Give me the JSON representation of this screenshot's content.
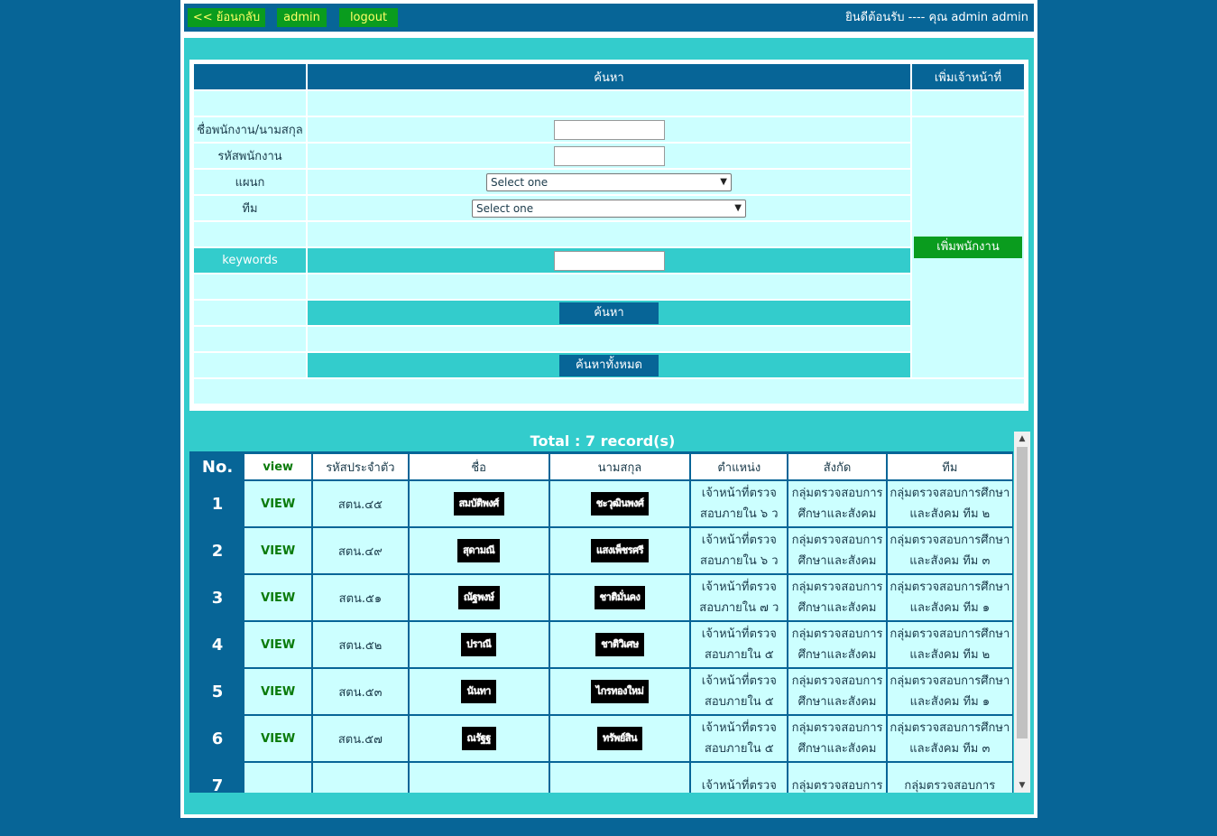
{
  "topbar": {
    "back_label": "<< ย้อนกลับ",
    "admin_label": "admin",
    "logout_label": "logout",
    "welcome_text": "ยินดีต้อนรับ ---- คุณ admin admin"
  },
  "search": {
    "header": "ค้นหา",
    "add_staff_header": "เพิ่มเจ้าหน้าที่",
    "name_label": "ชื่อพนักงาน/นามสกุล",
    "id_label": "รหัสพนักงาน",
    "department_label": "แผนก",
    "department_value": "Select one",
    "team_label": "ทีม",
    "team_value": "Select one",
    "keywords_label": "keywords",
    "search_button": "ค้นหา",
    "search_all_button": "ค้นหาทั้งหมด",
    "add_employee_button": "เพิ่มพนักงาน"
  },
  "results": {
    "total_text": "Total : 7 record(s)",
    "columns": {
      "no": "No.",
      "view": "view",
      "code": "รหัสประจำตัว",
      "first_name": "ชื่อ",
      "last_name": "นามสกุล",
      "position": "ตำแหน่ง",
      "affiliation": "สังกัด",
      "team": "ทีม"
    },
    "rows": [
      {
        "no": "1",
        "view": "VIEW",
        "code": "สตน.๔๕",
        "first_name": "สมบัติพงศ์",
        "last_name": "ชะวุฒินพงศ์",
        "position_1": "เจ้าหน้าที่ตรวจ",
        "position_2": "สอบภายใน ๖ ว",
        "aff_1": "กลุ่มตรวจสอบการ",
        "aff_2": "ศึกษาและสังคม",
        "team_1": "กลุ่มตรวจสอบการศึกษา",
        "team_2": "และสังคม ทีม ๒"
      },
      {
        "no": "2",
        "view": "VIEW",
        "code": "สตน.๔๙",
        "first_name": "สุดามณี",
        "last_name": "แสงเพ็ชรศรี",
        "position_1": "เจ้าหน้าที่ตรวจ",
        "position_2": "สอบภายใน ๖ ว",
        "aff_1": "กลุ่มตรวจสอบการ",
        "aff_2": "ศึกษาและสังคม",
        "team_1": "กลุ่มตรวจสอบการศึกษา",
        "team_2": "และสังคม ทีม ๓"
      },
      {
        "no": "3",
        "view": "VIEW",
        "code": "สตน.๕๑",
        "first_name": "ณัฐพงษ์",
        "last_name": "ชาติมั่นคง",
        "position_1": "เจ้าหน้าที่ตรวจ",
        "position_2": "สอบภายใน ๗ ว",
        "aff_1": "กลุ่มตรวจสอบการ",
        "aff_2": "ศึกษาและสังคม",
        "team_1": "กลุ่มตรวจสอบการศึกษา",
        "team_2": "และสังคม ทีม ๑"
      },
      {
        "no": "4",
        "view": "VIEW",
        "code": "สตน.๕๒",
        "first_name": "ปราณี",
        "last_name": "ชาติวิเศษ",
        "position_1": "เจ้าหน้าที่ตรวจ",
        "position_2": "สอบภายใน ๕",
        "aff_1": "กลุ่มตรวจสอบการ",
        "aff_2": "ศึกษาและสังคม",
        "team_1": "กลุ่มตรวจสอบการศึกษา",
        "team_2": "และสังคม ทีม ๒"
      },
      {
        "no": "5",
        "view": "VIEW",
        "code": "สตน.๕๓",
        "first_name": "นันทา",
        "last_name": "ไกรทองใหม่",
        "position_1": "เจ้าหน้าที่ตรวจ",
        "position_2": "สอบภายใน ๕",
        "aff_1": "กลุ่มตรวจสอบการ",
        "aff_2": "ศึกษาและสังคม",
        "team_1": "กลุ่มตรวจสอบการศึกษา",
        "team_2": "และสังคม ทีม ๑"
      },
      {
        "no": "6",
        "view": "VIEW",
        "code": "สตน.๕๗",
        "first_name": "ณรัฐฐ",
        "last_name": "ทรัพย์สิน",
        "position_1": "เจ้าหน้าที่ตรวจ",
        "position_2": "สอบภายใน ๕",
        "aff_1": "กลุ่มตรวจสอบการ",
        "aff_2": "ศึกษาและสังคม",
        "team_1": "กลุ่มตรวจสอบการศึกษา",
        "team_2": "และสังคม ทีม ๓"
      },
      {
        "no": "7",
        "view": "",
        "code": "",
        "first_name": "",
        "last_name": "",
        "position_1": "เจ้าหน้าที่ตรวจ",
        "position_2": "",
        "aff_1": "กลุ่มตรวจสอบการ",
        "aff_2": "",
        "team_1": "กลุ่มตรวจสอบการ",
        "team_2": ""
      }
    ]
  },
  "colors": {
    "page_bg": "#076597",
    "panel_teal": "#33cccc",
    "cell_light": "#ccffff",
    "button_green": "#0a9c1e",
    "button_text_yellow": "#ffff66"
  },
  "icons": {
    "select_arrow": "chevron-down-icon",
    "scroll_up": "chevron-up-icon",
    "scroll_down": "chevron-down-icon"
  }
}
